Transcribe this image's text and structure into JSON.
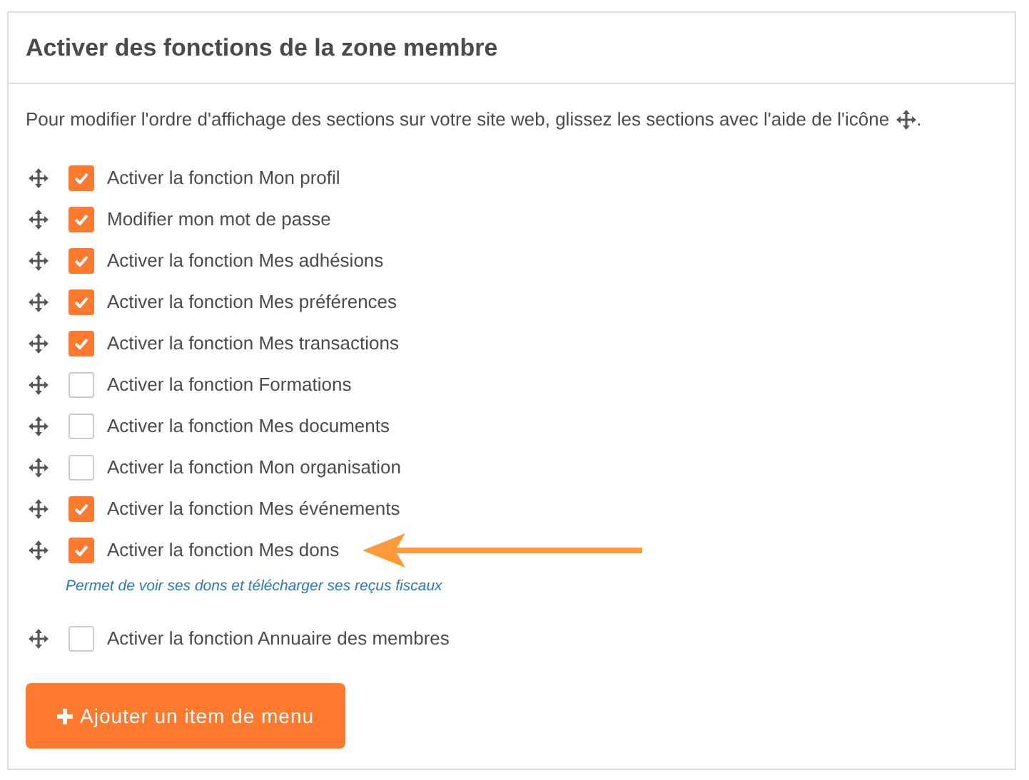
{
  "panel": {
    "title": "Activer des fonctions de la zone membre",
    "intro": "Pour modifier l'ordre d'affichage des sections sur votre site web, glissez les sections avec l'aide de l'icône",
    "intro_end": "."
  },
  "items": [
    {
      "label": "Activer la fonction Mon profil",
      "checked": true
    },
    {
      "label": "Modifier mon mot de passe",
      "checked": true
    },
    {
      "label": "Activer la fonction Mes adhésions",
      "checked": true
    },
    {
      "label": "Activer la fonction Mes préférences",
      "checked": true
    },
    {
      "label": "Activer la fonction Mes transactions",
      "checked": true
    },
    {
      "label": "Activer la fonction Formations",
      "checked": false
    },
    {
      "label": "Activer la fonction Mes documents",
      "checked": false
    },
    {
      "label": "Activer la fonction Mon organisation",
      "checked": false
    },
    {
      "label": "Activer la fonction Mes événements",
      "checked": true
    },
    {
      "label": "Activer la fonction Mes dons",
      "checked": true,
      "pointed": true,
      "note": "Permet de voir ses dons et télécharger ses reçus fiscaux"
    },
    {
      "label": "Activer la fonction Annuaire des membres",
      "checked": false
    }
  ],
  "add_button": "Ajouter un item de menu"
}
